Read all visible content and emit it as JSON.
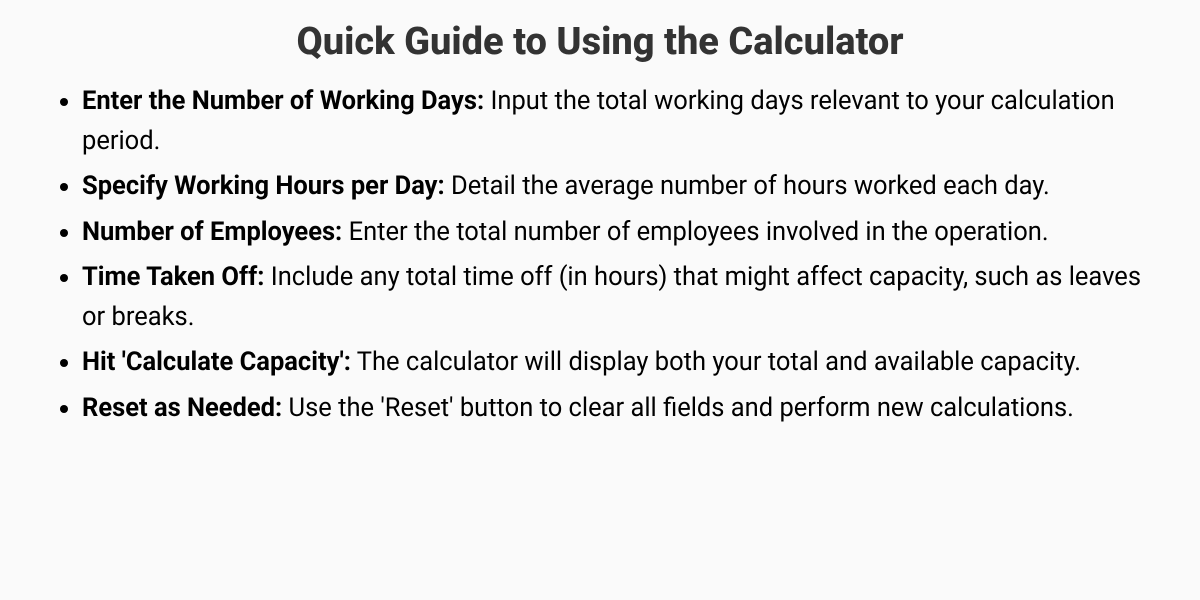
{
  "title": "Quick Guide to Using the Calculator",
  "items": [
    {
      "label": "Enter the Number of Working Days:",
      "desc": " Input the total working days relevant to your calculation period."
    },
    {
      "label": "Specify Working Hours per Day:",
      "desc": " Detail the average number of hours worked each day."
    },
    {
      "label": "Number of Employees:",
      "desc": " Enter the total number of employees involved in the operation."
    },
    {
      "label": "Time Taken Off:",
      "desc": " Include any total time off (in hours) that might affect capacity, such as leaves or breaks."
    },
    {
      "label": "Hit 'Calculate Capacity':",
      "desc": " The calculator will display both your total and available capacity."
    },
    {
      "label": "Reset as Needed:",
      "desc": " Use the 'Reset' button to clear all fields and perform new calculations."
    }
  ]
}
